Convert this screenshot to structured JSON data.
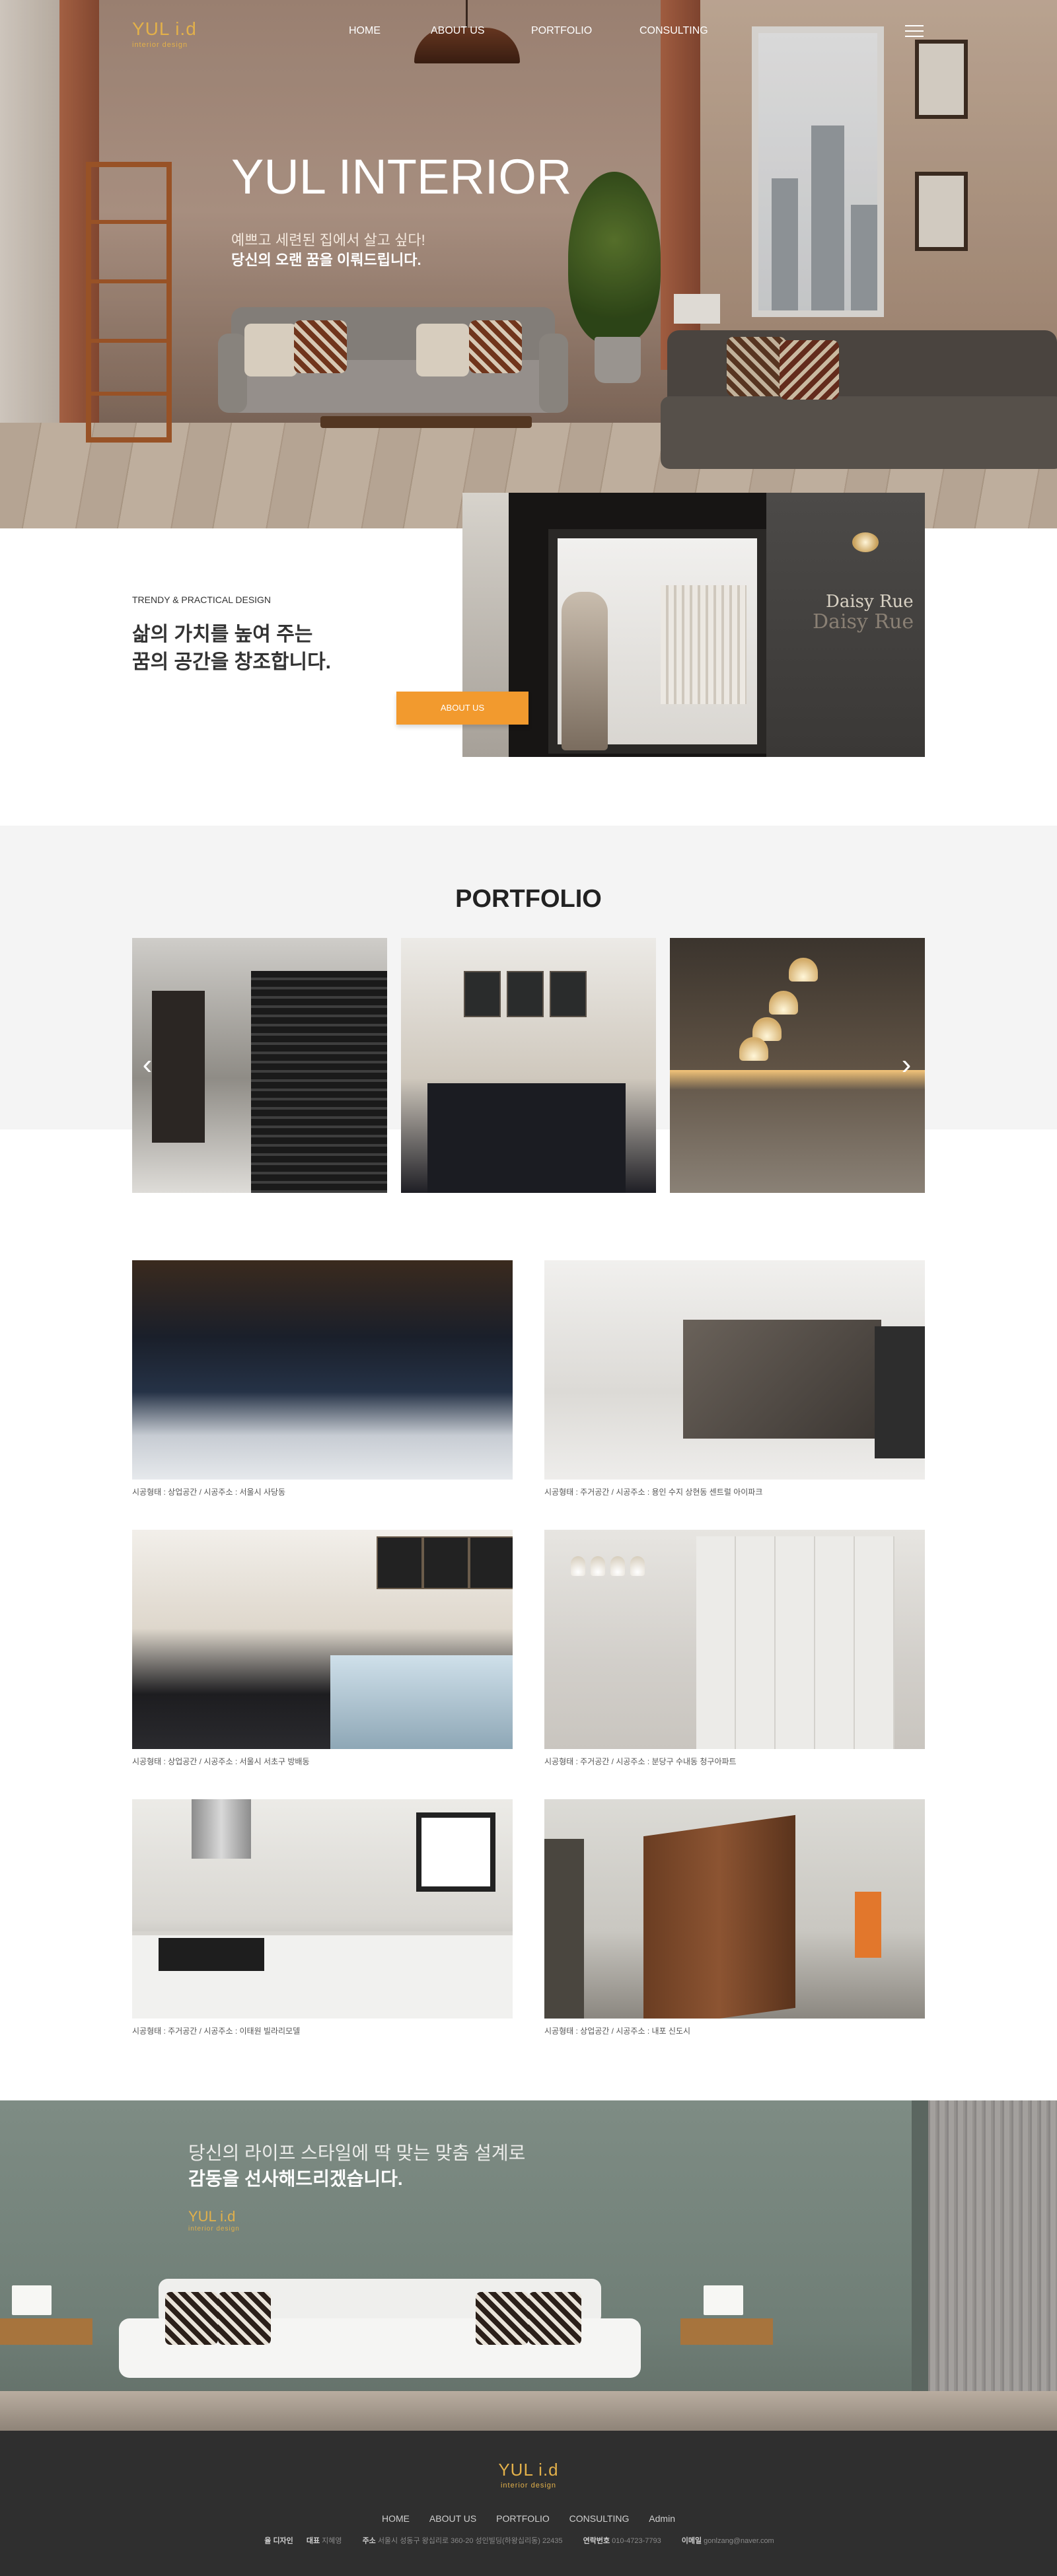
{
  "header": {
    "logo": "YUL i.d",
    "logo_sub": "interior design",
    "nav": [
      "HOME",
      "ABOUT US",
      "PORTFOLIO",
      "CONSULTING"
    ]
  },
  "hero": {
    "title": "YUL INTERIOR",
    "line1": "예쁘고 세련된 집에서 살고 싶다!",
    "line2": "당신의 오랜 꿈을 이뤄드립니다."
  },
  "about": {
    "small": "TRENDY & PRACTICAL DESIGN",
    "heading_line1": "삶의 가치를 높여 주는",
    "heading_line2": "꿈의 공간을 창조합니다.",
    "button": "ABOUT US",
    "sign_top": "Daisy Rue",
    "sign_bottom": "Daisy Rue"
  },
  "portfolio": {
    "title": "PORTFOLIO",
    "prev_icon": "chevron-left-icon",
    "next_icon": "chevron-right-icon",
    "prev_glyph": "‹",
    "next_glyph": "›"
  },
  "gallery": [
    {
      "caption": "시공형태 : 상업공간 / 시공주소 : 서울시 사당동"
    },
    {
      "caption": "시공형태 : 주거공간 / 시공주소 : 용인 수지 상현동 센트럴 아이파크"
    },
    {
      "caption": "시공형태 : 상업공간 / 시공주소 : 서울시 서초구 방배동"
    },
    {
      "caption": "시공형태 : 주거공간 / 시공주소 : 분당구 수내동 청구아파트"
    },
    {
      "caption": "시공형태 : 주거공간 / 시공주소 : 이태원 빌라리모델"
    },
    {
      "caption": "시공형태 : 상업공간 / 시공주소 : 내포 신도시"
    }
  ],
  "banner": {
    "line1": "당신의 라이프 스타일에 딱 맞는 맞춤 설계로",
    "line2": "감동을 선사해드리겠습니다.",
    "logo": "YUL i.d",
    "logo_sub": "interior design"
  },
  "footer": {
    "logo": "YUL i.d",
    "logo_sub": "interior design",
    "nav": [
      "HOME",
      "ABOUT US",
      "PORTFOLIO",
      "CONSULTING",
      "Admin"
    ],
    "info": {
      "company_label": "율 디자인",
      "ceo_label": "대표",
      "ceo": "지혜영",
      "address_label": "주소",
      "address": "서울시 성동구 왕십리로 360-20 성인빌딩(하왕십리동) 22435",
      "phone_label": "연락번호",
      "phone": "010-4723-7793",
      "email_label": "이메일",
      "email": "gonlzang@naver.com"
    }
  },
  "colors": {
    "accent": "#f29a2e",
    "logo": "#e2b04a",
    "footer_bg": "#2f2f2f",
    "section_bg": "#f4f4f4"
  }
}
